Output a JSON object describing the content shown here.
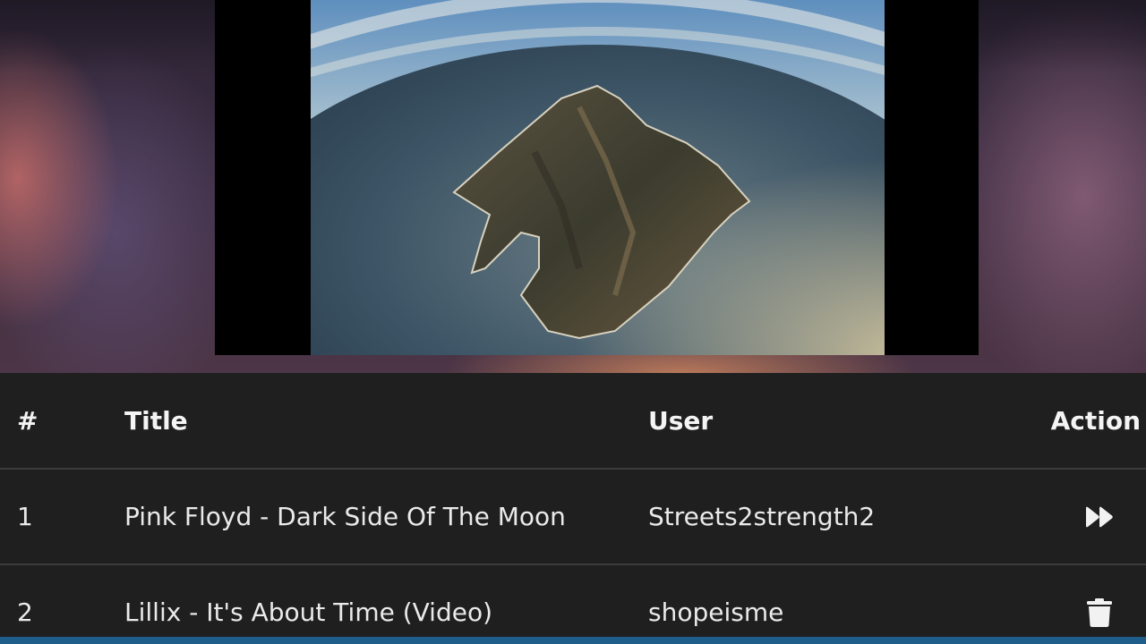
{
  "player": {
    "background_accent": "#ce865e",
    "letterbox_color": "#000000"
  },
  "queue": {
    "columns": {
      "number": "#",
      "title": "Title",
      "user": "User",
      "action": "Action"
    },
    "rows": [
      {
        "number": "1",
        "title": "Pink Floyd - Dark Side Of The Moon",
        "user": "Streets2strength2",
        "action_icon": "skip-forward-icon"
      },
      {
        "number": "2",
        "title": "Lillix - It's About Time (Video)",
        "user": "shopeisme",
        "action_icon": "trash-icon"
      }
    ]
  },
  "colors": {
    "table_background": "#1f1f1f",
    "divider": "#3b3b3b",
    "bottom_bar": "#1f5e8a",
    "text": "#eaeaea"
  }
}
